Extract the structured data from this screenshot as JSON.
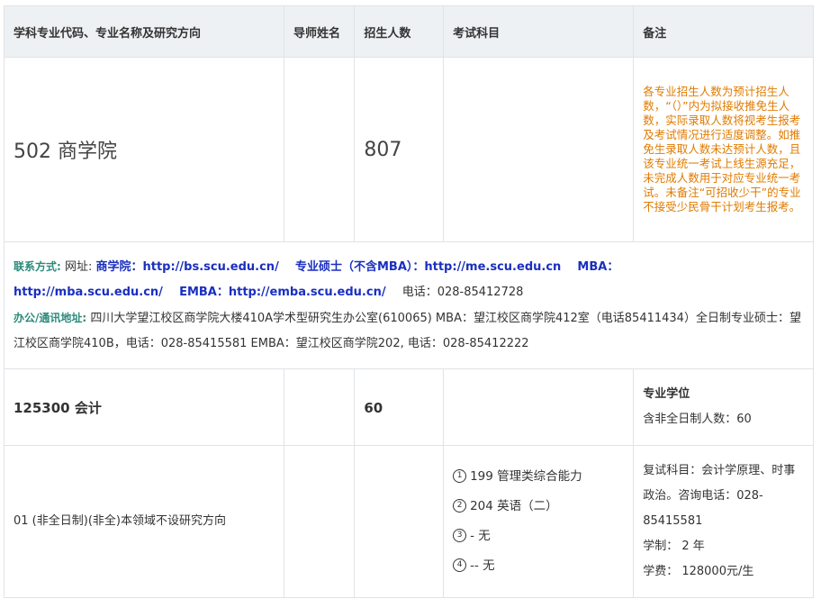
{
  "headers": {
    "major": "学科专业代码、专业名称及研究方向",
    "advisor": "导师姓名",
    "quota": "招生人数",
    "subjects": "考试科目",
    "notes": "备注"
  },
  "college": {
    "name": "502 商学院",
    "quota": "807",
    "note": "各专业招生人数为预计招生人数，“（）”内为拟接收推免生人数，实际录取人数将视考生报考及考试情况进行适度调整。如推免生录取人数未达预计人数，且该专业统一考试上线生源充足，未完成人数用于对应专业统一考试。未备注“可招收少干”的专业不接受少民骨干计划考生报考。"
  },
  "contact": {
    "label": "联系方式:",
    "website_label": "网址:",
    "link1": "商学院：http://bs.scu.edu.cn/",
    "link2": "专业硕士（不含MBA）：http://me.scu.edu.cn",
    "link3": "MBA：",
    "link4": "http://mba.scu.edu.cn/",
    "link5": "EMBA：http://emba.scu.edu.cn/",
    "phone": "电话：028-85412728",
    "address_label": "办公/通讯地址:",
    "address": "四川大学望江校区商学院大楼410A学术型研究生办公室(610065) MBA：望江校区商学院412室（电话85411434）全日制专业硕士：望江校区商学院410B，电话：028-85415581 EMBA：望江校区商学院202, 电话：028-85412222"
  },
  "major": {
    "name": "125300 会计",
    "quota": "60",
    "degree_type": "专业学位",
    "parttime_count": "含非全日制人数：60"
  },
  "direction": {
    "name": "01 (非全日制)(非全)本领域不设研究方向",
    "subjects": [
      {
        "num": "1",
        "text": "199 管理类综合能力"
      },
      {
        "num": "2",
        "text": "204 英语（二）"
      },
      {
        "num": "3",
        "text": "- 无"
      },
      {
        "num": "4",
        "text": "-- 无"
      }
    ],
    "retest": "复试科目：会计学原理、时事政治。咨询电话：028-85415581",
    "duration": "学制：  2 年",
    "tuition": "学费：  128000元/生"
  }
}
